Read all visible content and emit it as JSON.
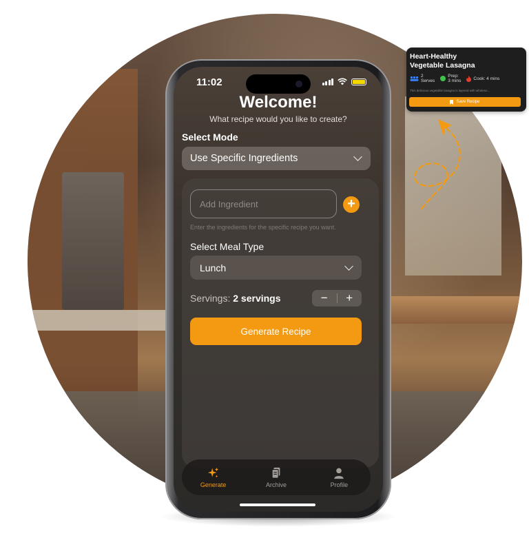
{
  "status_bar": {
    "time": "11:02"
  },
  "header": {
    "title": "Welcome!",
    "subtitle": "What recipe would you like to create?"
  },
  "mode": {
    "label": "Select Mode",
    "selected": "Use Specific Ingredients"
  },
  "ingredients": {
    "placeholder": "Add Ingredient",
    "value": "",
    "hint": "Enter the ingredients for the specific recipe you want."
  },
  "meal_type": {
    "label": "Select Meal Type",
    "selected": "Lunch"
  },
  "servings": {
    "label": "Servings:",
    "value": "2 servings",
    "decrement": "−",
    "increment": "+"
  },
  "generate_button": "Generate Recipe",
  "tabs": [
    {
      "label": "Generate",
      "icon": "sparkles-icon",
      "active": true
    },
    {
      "label": "Archive",
      "icon": "documents-icon",
      "active": false
    },
    {
      "label": "Profile",
      "icon": "person-icon",
      "active": false
    }
  ],
  "recipe_card": {
    "title_line1": "Heart-Healthy",
    "title_line2": "Vegetable Lasagna",
    "serves_count": "2",
    "serves_label": "Serves",
    "prep_label": "Prep:",
    "prep_value": "3 mins",
    "cook": "Cook: 4 mins",
    "description": "This delicious vegetable lasagna is layered with wholeso...",
    "save_label": "Save Recipe"
  },
  "colors": {
    "accent": "#f39a12",
    "serves_icon": "#3b82f6",
    "prep_icon": "#3ec24a",
    "cook_icon": "#e53e2e"
  }
}
